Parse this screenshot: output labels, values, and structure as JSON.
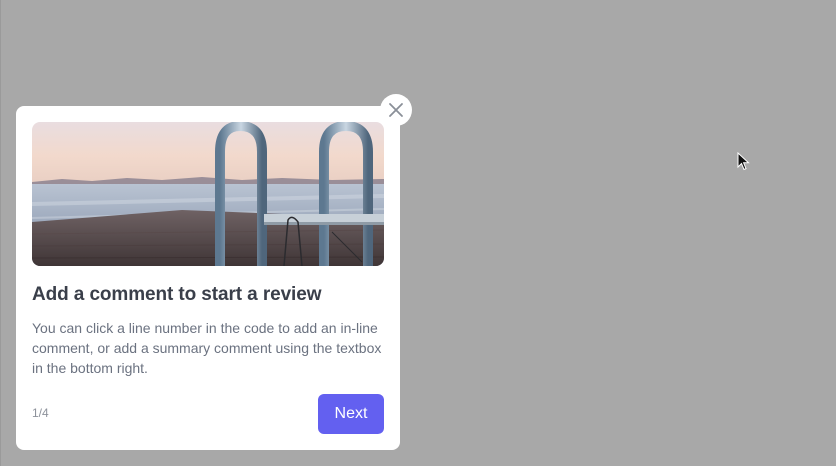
{
  "onboarding": {
    "title": "Add a comment to start a review",
    "description": "You can click a line number in the code to add an in-line comment, or add a summary comment using the textbox in the bottom right.",
    "step_counter": "1/4",
    "next_label": "Next",
    "close_icon": "close-icon",
    "image_subject": "lake-dock-ladder"
  },
  "colors": {
    "backdrop": "#a8a8a8",
    "card": "#ffffff",
    "accent": "#6360f0",
    "title": "#3a3f4a",
    "body": "#6b7280"
  }
}
